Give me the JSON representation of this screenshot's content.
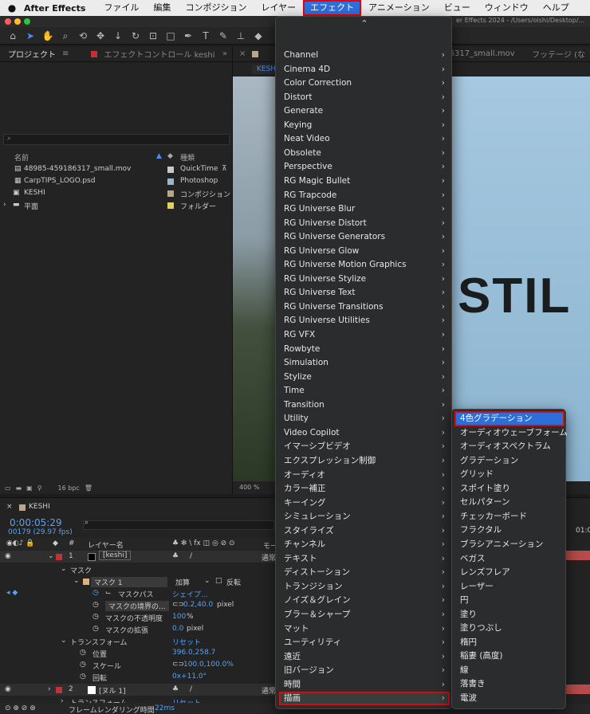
{
  "menubar": {
    "app_name": "After Effects",
    "items": [
      "ファイル",
      "編集",
      "コンポジション",
      "レイヤー",
      "エフェクト",
      "アニメーション",
      "ビュー",
      "ウィンドウ",
      "ヘルプ"
    ],
    "active_item": "エフェクト"
  },
  "window": {
    "title_fragment": "er Effects 2024 - /Users/oishi/Desktop/..."
  },
  "project_panel": {
    "tab_label": "プロジェクト",
    "effect_controls_tab": "エフェクトコントロール keshi",
    "columns": {
      "name": "名前",
      "type": "種類"
    },
    "items": [
      {
        "name": "48985-459186317_small.mov",
        "type": "QuickTime",
        "color": "#c8c8c8"
      },
      {
        "name": "CarpTIPS_LOGO.psd",
        "type": "Photoshop",
        "color": "#9ab8c8"
      },
      {
        "name": "KESHI",
        "type": "コンポジション",
        "color": "#b8a888"
      },
      {
        "name": "平面",
        "type": "フォルダー",
        "color": "#e0d060"
      }
    ],
    "bpc": "16 bpc"
  },
  "viewer": {
    "tab_label": "KESHI",
    "footage_file": "48985-459186317_small.mov",
    "footage_label": "フッテージ (な",
    "sign_text": "STIL",
    "zoom": "400 %"
  },
  "timeline": {
    "comp_name": "KESHI",
    "timecode": "0:00:05:29",
    "frames": "00179 (29.97 fps)",
    "column_layer_name": "レイヤー名",
    "mode_header": "モー",
    "ruler_mark": "01:0",
    "layers": [
      {
        "num": "1",
        "name": "[keshi]",
        "mode": "通常"
      },
      {
        "num": "2",
        "name": "[ヌル 1]",
        "mode": "通常"
      }
    ],
    "mask_group": "マスク",
    "mask_name": "マスク 1",
    "mask_mode": "加算",
    "mask_invert": "反転",
    "mask_path": "マスクパス",
    "mask_path_value": "シェイプ...",
    "mask_feather": "マスクの境界の...",
    "mask_feather_value": "0.2,40.0",
    "mask_feather_unit": "pixel",
    "mask_opacity": "マスクの不透明度",
    "mask_opacity_value": "100",
    "mask_opacity_unit": "%",
    "mask_expansion": "マスクの拡張",
    "mask_expansion_value": "0.0",
    "mask_expansion_unit": "pixel",
    "transform": "トランスフォーム",
    "reset": "リセット",
    "position": "位置",
    "position_value": "396.0,258.7",
    "scale": "スケール",
    "scale_value": "100.0,100.0%",
    "rotation": "回転",
    "rotation_value": "0x+11.0°",
    "transform2": "トランスフォーム",
    "reset2": "リセット",
    "render_time": "フレームレンダリング時間",
    "render_time_value": "22ms"
  },
  "effect_menu": {
    "items": [
      "Channel",
      "Cinema 4D",
      "Color Correction",
      "Distort",
      "Generate",
      "Keying",
      "Neat Video",
      "Obsolete",
      "Perspective",
      "RG Magic Bullet",
      "RG Trapcode",
      "RG Universe Blur",
      "RG Universe Distort",
      "RG Universe Generators",
      "RG Universe Glow",
      "RG Universe Motion Graphics",
      "RG Universe Stylize",
      "RG Universe Text",
      "RG Universe Transitions",
      "RG Universe Utilities",
      "RG VFX",
      "Rowbyte",
      "Simulation",
      "Stylize",
      "Time",
      "Transition",
      "Utility",
      "Video Copilot",
      "イマーシブビデオ",
      "エクスプレッション制御",
      "オーディオ",
      "カラー補正",
      "キーイング",
      "シミュレーション",
      "スタイライズ",
      "チャンネル",
      "テキスト",
      "ディストーション",
      "トランジション",
      "ノイズ＆グレイン",
      "ブラー＆シャープ",
      "マット",
      "ユーティリティ",
      "遠近",
      "旧バージョン",
      "時間",
      "描画"
    ],
    "highlighted": "描画"
  },
  "submenu": {
    "items": [
      "4色グラデーション",
      "オーディオウェーブフォーム",
      "オーディオスペクトラム",
      "グラデーション",
      "グリッド",
      "スポイト塗り",
      "セルパターン",
      "チェッカーボード",
      "フラクタル",
      "ブラシアニメーション",
      "ベガス",
      "レンズフレア",
      "レーザー",
      "円",
      "塗り",
      "塗りつぶし",
      "楕円",
      "稲妻 (高度)",
      "線",
      "落書き",
      "電波"
    ],
    "selected": "4色グラデーション"
  }
}
